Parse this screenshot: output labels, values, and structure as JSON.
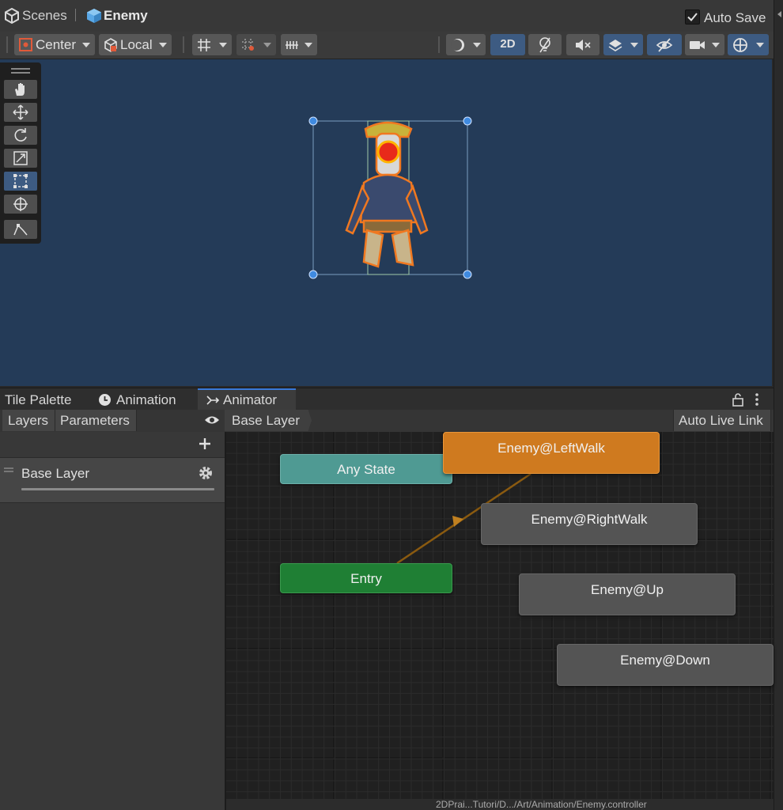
{
  "breadcrumb": {
    "root": "Scenes",
    "current": "Enemy"
  },
  "auto_save": {
    "label": "Auto Save",
    "checked": true
  },
  "scene_toolbar": {
    "pivot": "Center",
    "space": "Local",
    "mode_2d": "2D"
  },
  "tools": [
    "hand-tool",
    "move-tool",
    "rotate-tool",
    "scale-tool",
    "rect-tool",
    "transform-tool",
    "custom-editor-tool"
  ],
  "bottom_tabs": [
    "Tile Palette",
    "Animation",
    "Animator"
  ],
  "animator": {
    "sub_tabs": [
      "Layers",
      "Parameters"
    ],
    "breadcrumb": "Base Layer",
    "auto_live_link": "Auto Live Link",
    "layer_name": "Base Layer",
    "nodes": {
      "any_state": "Any State",
      "entry": "Entry",
      "left_walk": "Enemy@LeftWalk",
      "right_walk": "Enemy@RightWalk",
      "up": "Enemy@Up",
      "down": "Enemy@Down"
    },
    "status_path": "2DPrai...Tutori/D.../Art/Animation/Enemy.controller"
  },
  "colors": {
    "scene_bg": "#243b58",
    "any_state": "#4f9a93",
    "entry": "#1f7f34",
    "default_state": "#cf7a1f",
    "state": "#545454",
    "accent_blue": "#3d5b82"
  }
}
